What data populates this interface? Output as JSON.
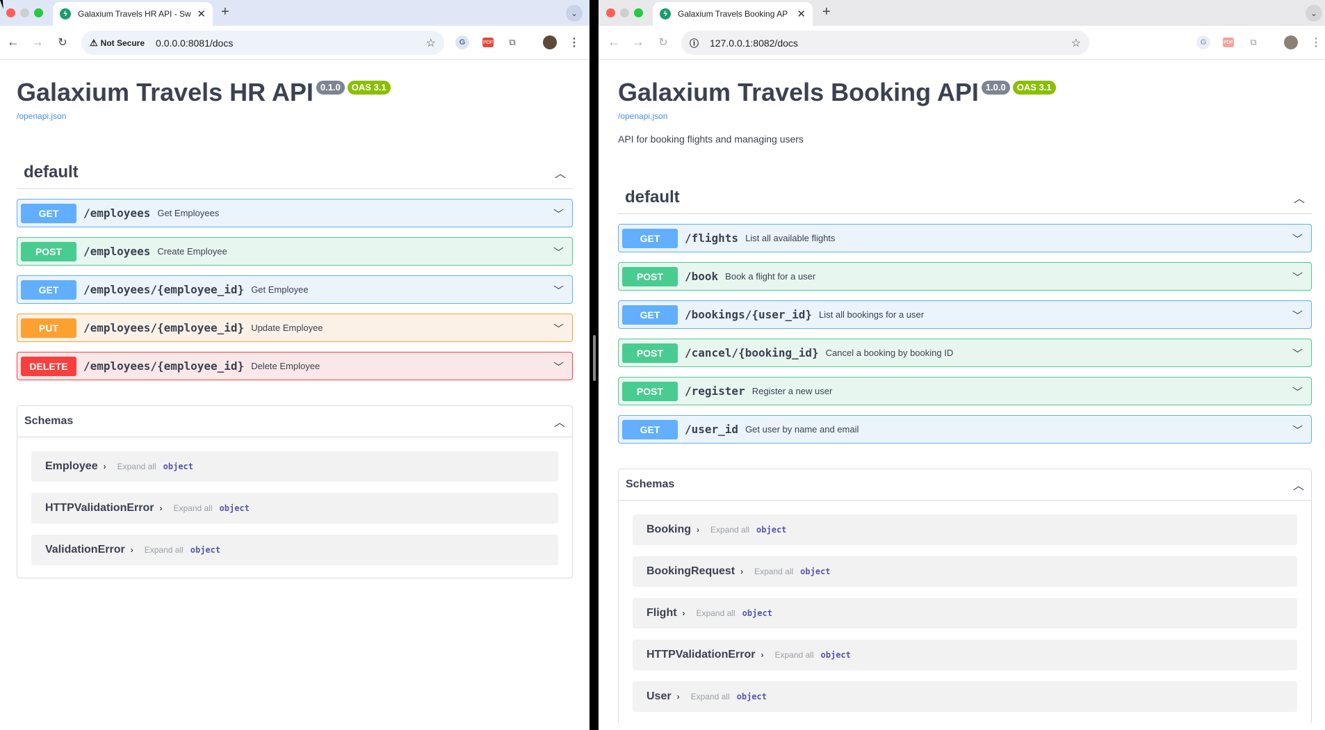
{
  "left": {
    "tab_title": "Galaxium Travels HR API - Sw",
    "security_label": "Not Secure",
    "url": "0.0.0.0:8081/docs",
    "api_title": "Galaxium Travels HR API",
    "version": "0.1.0",
    "oas": "OAS 3.1",
    "openapi_link": "/openapi.json",
    "section_title": "default",
    "operations": [
      {
        "method": "GET",
        "path": "/employees",
        "summary": "Get Employees"
      },
      {
        "method": "POST",
        "path": "/employees",
        "summary": "Create Employee"
      },
      {
        "method": "GET",
        "path": "/employees/{employee_id}",
        "summary": "Get Employee"
      },
      {
        "method": "PUT",
        "path": "/employees/{employee_id}",
        "summary": "Update Employee"
      },
      {
        "method": "DELETE",
        "path": "/employees/{employee_id}",
        "summary": "Delete Employee"
      }
    ],
    "schemas_title": "Schemas",
    "schemas": [
      {
        "name": "Employee",
        "expand": "Expand all",
        "type": "object"
      },
      {
        "name": "HTTPValidationError",
        "expand": "Expand all",
        "type": "object"
      },
      {
        "name": "ValidationError",
        "expand": "Expand all",
        "type": "object"
      }
    ]
  },
  "right": {
    "tab_title": "Galaxium Travels Booking AP",
    "url": "127.0.0.1:8082/docs",
    "api_title": "Galaxium Travels Booking API",
    "version": "1.0.0",
    "oas": "OAS 3.1",
    "openapi_link": "/openapi.json",
    "description": "API for booking flights and managing users",
    "section_title": "default",
    "operations": [
      {
        "method": "GET",
        "path": "/flights",
        "summary": "List all available flights"
      },
      {
        "method": "POST",
        "path": "/book",
        "summary": "Book a flight for a user"
      },
      {
        "method": "GET",
        "path": "/bookings/{user_id}",
        "summary": "List all bookings for a user"
      },
      {
        "method": "POST",
        "path": "/cancel/{booking_id}",
        "summary": "Cancel a booking by booking ID"
      },
      {
        "method": "POST",
        "path": "/register",
        "summary": "Register a new user"
      },
      {
        "method": "GET",
        "path": "/user_id",
        "summary": "Get user by name and email"
      }
    ],
    "schemas_title": "Schemas",
    "schemas": [
      {
        "name": "Booking",
        "expand": "Expand all",
        "type": "object"
      },
      {
        "name": "BookingRequest",
        "expand": "Expand all",
        "type": "object"
      },
      {
        "name": "Flight",
        "expand": "Expand all",
        "type": "object"
      },
      {
        "name": "HTTPValidationError",
        "expand": "Expand all",
        "type": "object"
      },
      {
        "name": "User",
        "expand": "Expand all",
        "type": "object"
      }
    ]
  },
  "colors": {
    "get": "#61affe",
    "post": "#49cc90",
    "put": "#fca130",
    "delete": "#f93e3e",
    "oas": "#89bf04"
  }
}
